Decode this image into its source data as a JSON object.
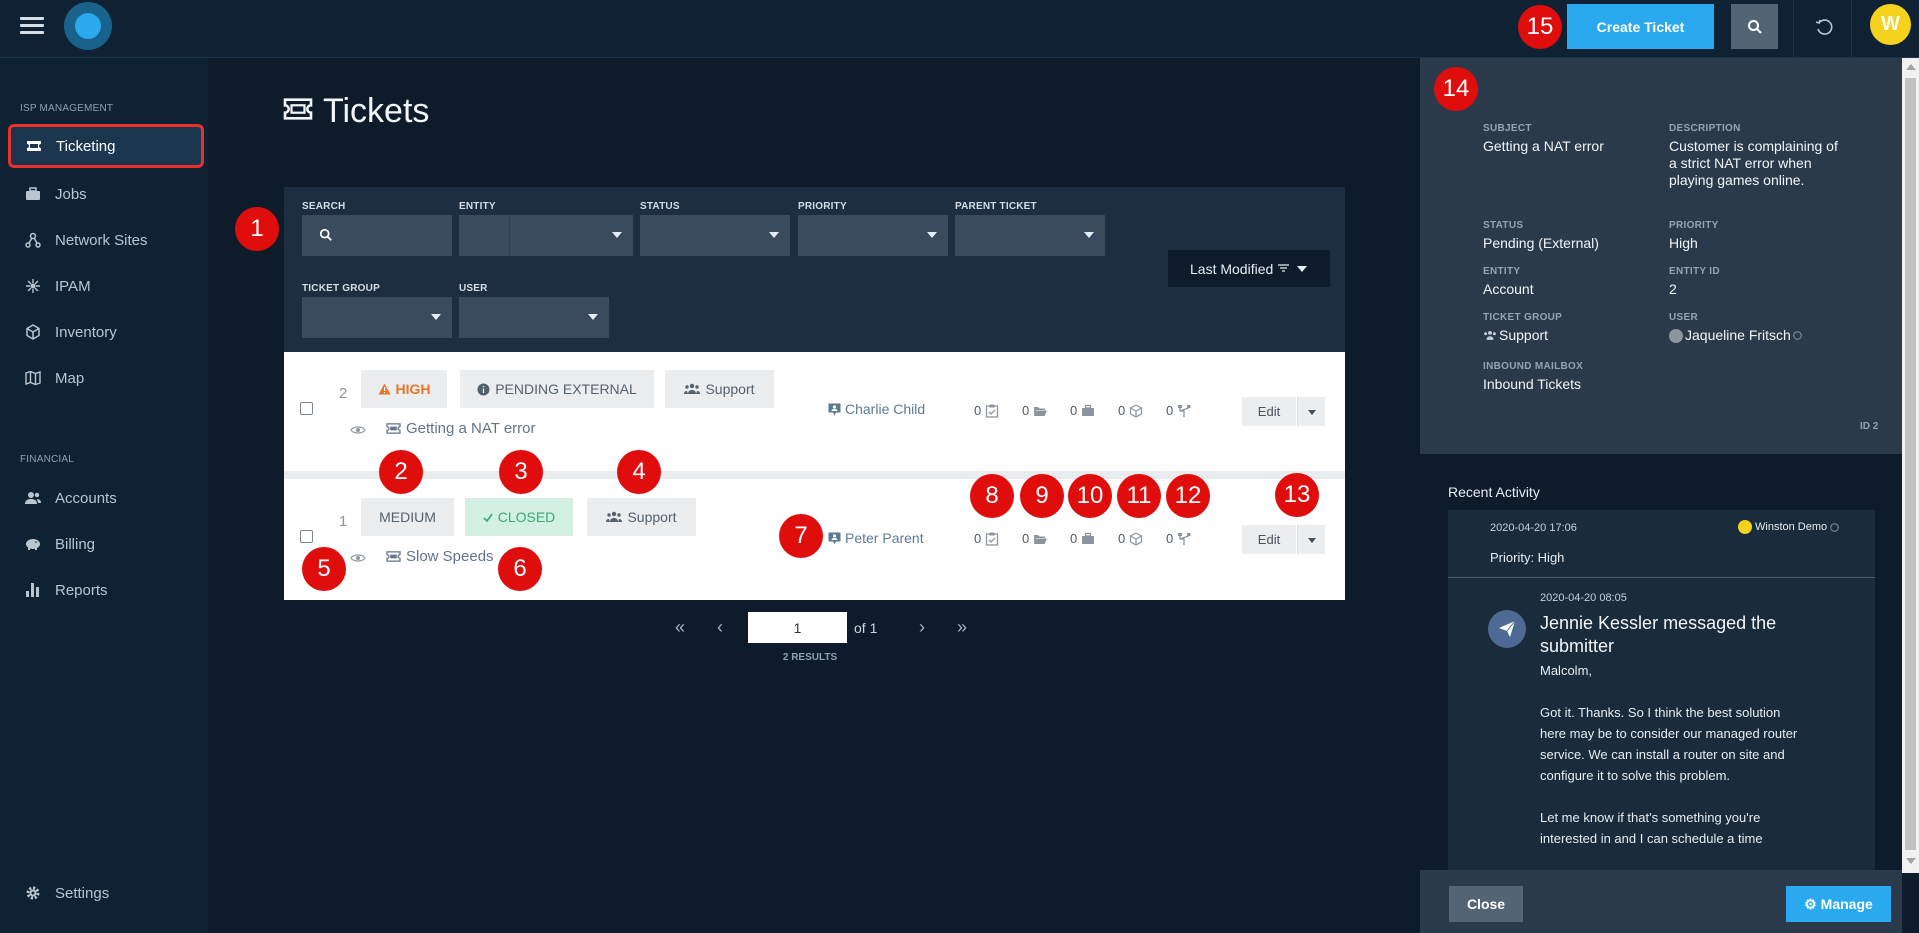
{
  "topbar": {
    "create_label": "Create Ticket",
    "avatar_initial": "W"
  },
  "sidebar": {
    "section_isp": "ISP MANAGEMENT",
    "section_financial": "FINANCIAL",
    "items": [
      {
        "label": "Ticketing",
        "icon": "ticket-icon"
      },
      {
        "label": "Jobs",
        "icon": "briefcase-icon"
      },
      {
        "label": "Network Sites",
        "icon": "network-icon"
      },
      {
        "label": "IPAM",
        "icon": "ipam-icon"
      },
      {
        "label": "Inventory",
        "icon": "cube-icon"
      },
      {
        "label": "Map",
        "icon": "map-icon"
      },
      {
        "label": "Accounts",
        "icon": "users-icon"
      },
      {
        "label": "Billing",
        "icon": "piggy-bank-icon"
      },
      {
        "label": "Reports",
        "icon": "bar-chart-icon"
      },
      {
        "label": "Settings",
        "icon": "gear-icon"
      }
    ]
  },
  "main": {
    "title": "Tickets",
    "filters": {
      "search": "SEARCH",
      "entity": "ENTITY",
      "status": "STATUS",
      "priority": "PRIORITY",
      "parent_ticket": "PARENT TICKET",
      "ticket_group": "TICKET GROUP",
      "user": "USER"
    },
    "sort_label": "Last Modified",
    "tickets": [
      {
        "id": "2",
        "priority": "HIGH",
        "status": "PENDING EXTERNAL",
        "group": "Support",
        "subject": "Getting a NAT error",
        "person": "Charlie Child",
        "counts": [
          "0",
          "0",
          "0",
          "0",
          "0"
        ],
        "edit": "Edit"
      },
      {
        "id": "1",
        "priority": "MEDIUM",
        "status": "CLOSED",
        "group": "Support",
        "subject": "Slow Speeds",
        "person": "Peter Parent",
        "counts": [
          "0",
          "0",
          "0",
          "0",
          "0"
        ],
        "edit": "Edit"
      }
    ],
    "pager": {
      "page": "1",
      "of": "of 1",
      "results": "2 RESULTS"
    }
  },
  "detail": {
    "subject_label": "SUBJECT",
    "subject": "Getting a NAT error",
    "description_label": "DESCRIPTION",
    "description": "Customer is complaining of a strict NAT error when playing games online.",
    "status_label": "STATUS",
    "status": "Pending (External)",
    "priority_label": "PRIORITY",
    "priority": "High",
    "entity_label": "ENTITY",
    "entity": "Account",
    "entity_id_label": "ENTITY ID",
    "entity_id": "2",
    "ticket_group_label": "TICKET GROUP",
    "ticket_group": "Support",
    "user_label": "USER",
    "user": "Jaqueline Fritsch",
    "mailbox_label": "INBOUND MAILBOX",
    "mailbox": "Inbound Tickets",
    "id_tag": "ID 2",
    "recent_title": "Recent Activity",
    "activity1": {
      "time": "2020-04-20 17:06",
      "user": "Winston Demo",
      "text": "Priority: High"
    },
    "activity2": {
      "time": "2020-04-20 08:05",
      "heading": "Jennie Kessler messaged the submitter",
      "greeting": "Malcolm,",
      "para1": "Got it. Thanks. So I think the best solution here may be to consider our managed router service. We can install a router on site and configure it to solve this problem.",
      "para2": "Let me know if that's something you're interested in and I can schedule a time"
    },
    "close_label": "Close",
    "manage_label": "Manage"
  },
  "markers": [
    "1",
    "2",
    "3",
    "4",
    "5",
    "6",
    "7",
    "8",
    "9",
    "10",
    "11",
    "12",
    "13",
    "14",
    "15"
  ],
  "colors": {
    "accent": "#2aa9ef",
    "marker": "#e00d0d",
    "high": "#e8752a",
    "closed": "#3aa871"
  }
}
